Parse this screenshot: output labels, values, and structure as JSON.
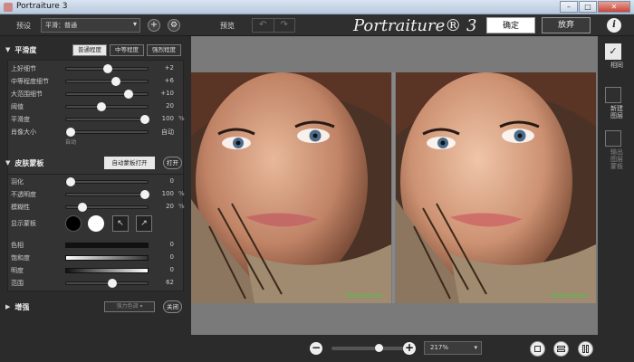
{
  "window": {
    "title": "Portraiture 3",
    "buttons": {
      "minimize": "–",
      "maximize": "□",
      "close": "✕"
    }
  },
  "toolbar": {
    "preset_label": "预设",
    "preset_value": "平滑：普通",
    "add": "+",
    "settings": "⚙",
    "preview_label": "预览",
    "undo": "↶",
    "redo": "↷",
    "logo": "Portraiture® 3",
    "ok": "确定",
    "cancel": "放弃",
    "info": "i"
  },
  "smoothing": {
    "title": "平滑度",
    "tabs": [
      "普通程度",
      "中等程度",
      "强烈程度"
    ],
    "sliders": [
      {
        "name": "上好细节",
        "value": "+2",
        "level": 0.5
      },
      {
        "name": "中等程度细节",
        "value": "+6",
        "level": 0.6
      },
      {
        "name": "大范围细节",
        "value": "+10",
        "level": 0.75
      },
      {
        "name": "阈值",
        "value": "20",
        "level": 0.42
      },
      {
        "name": "平滑度",
        "value": "100",
        "unit": "%",
        "level": 0.95
      }
    ],
    "feature_size": {
      "name": "肖像大小",
      "value": "自动",
      "sub_label": "自动",
      "level": 0.05
    }
  },
  "skin_mask": {
    "title": "皮肤蒙板",
    "auto_mask_button": "自动蒙板打开",
    "toggle": "打开",
    "sliders": [
      {
        "name": "羽化",
        "value": "0",
        "level": 0.05
      },
      {
        "name": "不透明度",
        "value": "100",
        "unit": "%",
        "level": 0.95
      },
      {
        "name": "模糊性",
        "value": "20",
        "unit": "%",
        "level": 0.2
      }
    ],
    "show_mask_label": "显示蒙板",
    "pickers": [
      "↖",
      "↗"
    ],
    "color_sliders": [
      {
        "name": "色相",
        "value": "0"
      },
      {
        "name": "饱和度",
        "value": "0"
      },
      {
        "name": "明度",
        "value": "0"
      },
      {
        "name": "范围",
        "value": "62",
        "level": 0.55
      }
    ]
  },
  "enhance": {
    "title": "增强",
    "dropdown": "强力色调",
    "toggle": "关闭"
  },
  "preview": {
    "watermark_left": "Portraiture",
    "watermark_right": "Portraiture"
  },
  "rightbar": {
    "check": "✓",
    "labels": [
      "相同",
      "新建图层",
      "输出图层蒙板"
    ]
  },
  "bottombar": {
    "zoom_out": "−",
    "zoom_in": "+",
    "zoom_value": "217%",
    "zoom_level": 0.65,
    "arrow": "▾"
  }
}
